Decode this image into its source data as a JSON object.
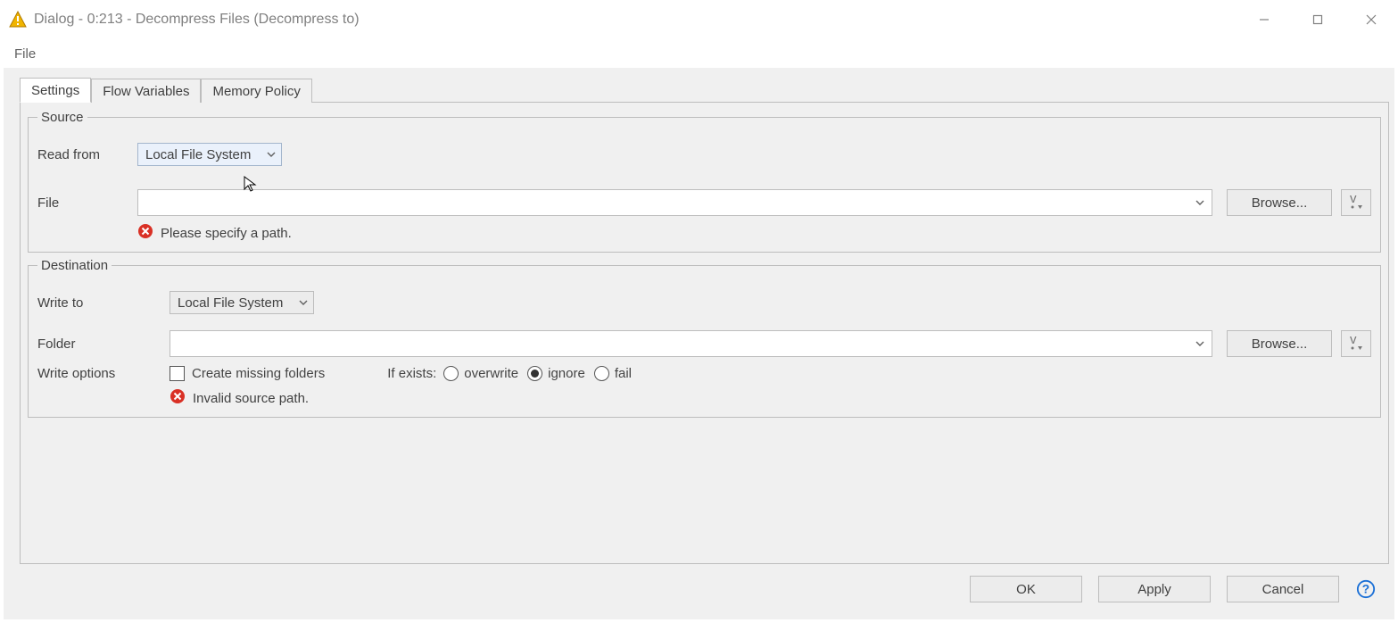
{
  "window_title": "Dialog - 0:213 - Decompress Files (Decompress to)",
  "menu": {
    "file": "File"
  },
  "tabs": {
    "settings": "Settings",
    "flow": "Flow Variables",
    "memory": "Memory Policy"
  },
  "source": {
    "legend": "Source",
    "read_from_label": "Read from",
    "read_from_value": "Local File System",
    "file_label": "File",
    "file_value": "",
    "browse": "Browse...",
    "error": "Please specify a path."
  },
  "destination": {
    "legend": "Destination",
    "write_to_label": "Write to",
    "write_to_value": "Local File System",
    "folder_label": "Folder",
    "folder_value": "",
    "browse": "Browse...",
    "write_options_label": "Write options",
    "create_missing": "Create missing folders",
    "if_exists_label": "If exists:",
    "opt_overwrite": "overwrite",
    "opt_ignore": "ignore",
    "opt_fail": "fail",
    "error": "Invalid source path."
  },
  "footer": {
    "ok": "OK",
    "apply": "Apply",
    "cancel": "Cancel"
  }
}
